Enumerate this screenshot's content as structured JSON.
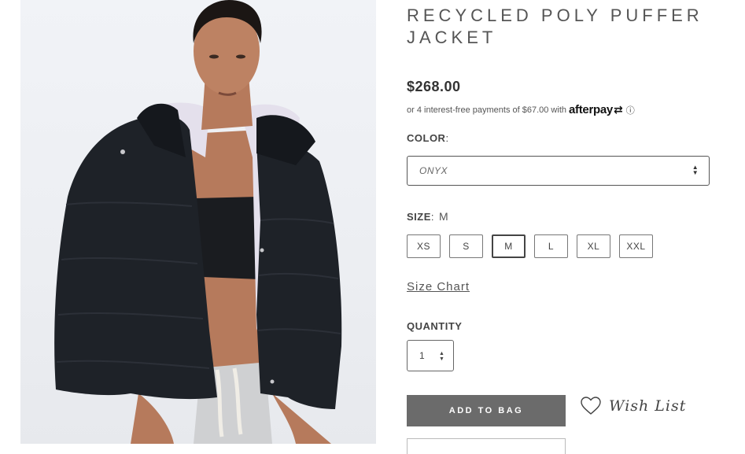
{
  "product": {
    "title": "RECYCLED POLY PUFFER JACKET",
    "price": "$268.00",
    "image_alt": "Model wearing black puffer jacket"
  },
  "afterpay": {
    "text": "or 4 interest-free payments of $67.00 with",
    "logo": "afterpay",
    "info_icon": "info-circle-icon"
  },
  "color": {
    "label": "COLOR",
    "selected": "ONYX"
  },
  "size": {
    "label": "SIZE",
    "selected": "M",
    "options": [
      "XS",
      "S",
      "M",
      "L",
      "XL",
      "XXL"
    ]
  },
  "size_chart": "Size Chart",
  "quantity": {
    "label": "QUANTITY",
    "value": "1"
  },
  "actions": {
    "add_to_bag": "ADD TO BAG",
    "wish_list": "Wish List"
  },
  "colors": {
    "button_bg": "#6b6b6b",
    "jacket": "#1e2228",
    "lining": "#e4e0ec"
  }
}
